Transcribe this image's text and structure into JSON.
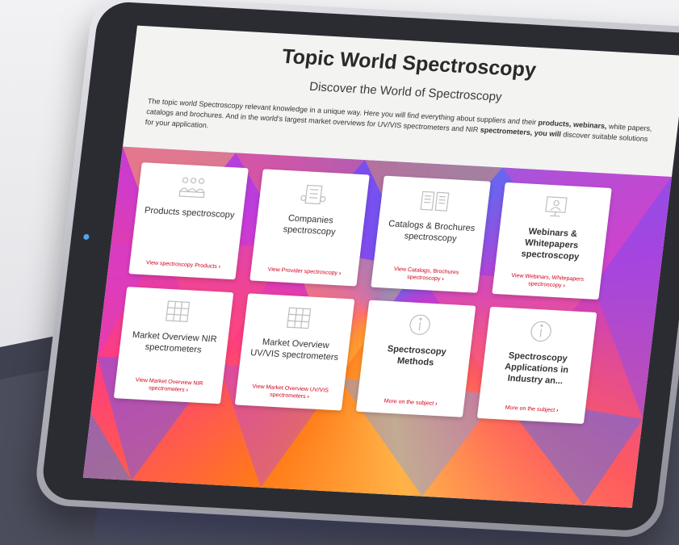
{
  "screen": {
    "title": "Topic World Spectroscopy",
    "subtitle": "Discover the World of Spectroscopy",
    "intro_part1": "The topic world Spectroscopy relevant knowledge in a unique way. Here you will find everything about suppliers and their ",
    "intro_bold1": "products, webinars,",
    "intro_part2": " white papers, catalogs and brochures. And in the world's largest market overviews for UV/VIS spectrometers and NIR ",
    "intro_bold2": "spectrometers, you will",
    "intro_part3": " discover suitable solutions for your application."
  },
  "cards": [
    {
      "icon": "people-icon",
      "title": "Products spectroscopy",
      "link": "View spectroscopy Products"
    },
    {
      "icon": "companies-icon",
      "title": "Companies spectroscopy",
      "link": "View Provider spectroscopy"
    },
    {
      "icon": "book-icon",
      "title": "Catalogs & Brochures spectroscopy",
      "link": "View Catalogs, Brochures spectroscopy"
    },
    {
      "icon": "monitor-user-icon",
      "title": "Webinars & Whitepapers spectroscopy",
      "link": "View Webinars, Whitepapers spectroscopy"
    },
    {
      "icon": "grid-icon",
      "title": "Market Overview NIR spectrometers",
      "link": "View Market Overview NIR spectrometers"
    },
    {
      "icon": "grid-icon",
      "title": "Market Overview UV/VIS spectrometers",
      "link": "View Market Overview UV/VIS spectrometers"
    },
    {
      "icon": "info-icon",
      "title": "Spectroscopy Methods",
      "link": "More on the subject"
    },
    {
      "icon": "info-icon",
      "title": "Spectroscopy Applications in Industry an...",
      "link": "More on the subject"
    }
  ],
  "colors": {
    "link": "#d0021b",
    "camera": "#4fa6ea",
    "bezel": "#2b2c32"
  }
}
